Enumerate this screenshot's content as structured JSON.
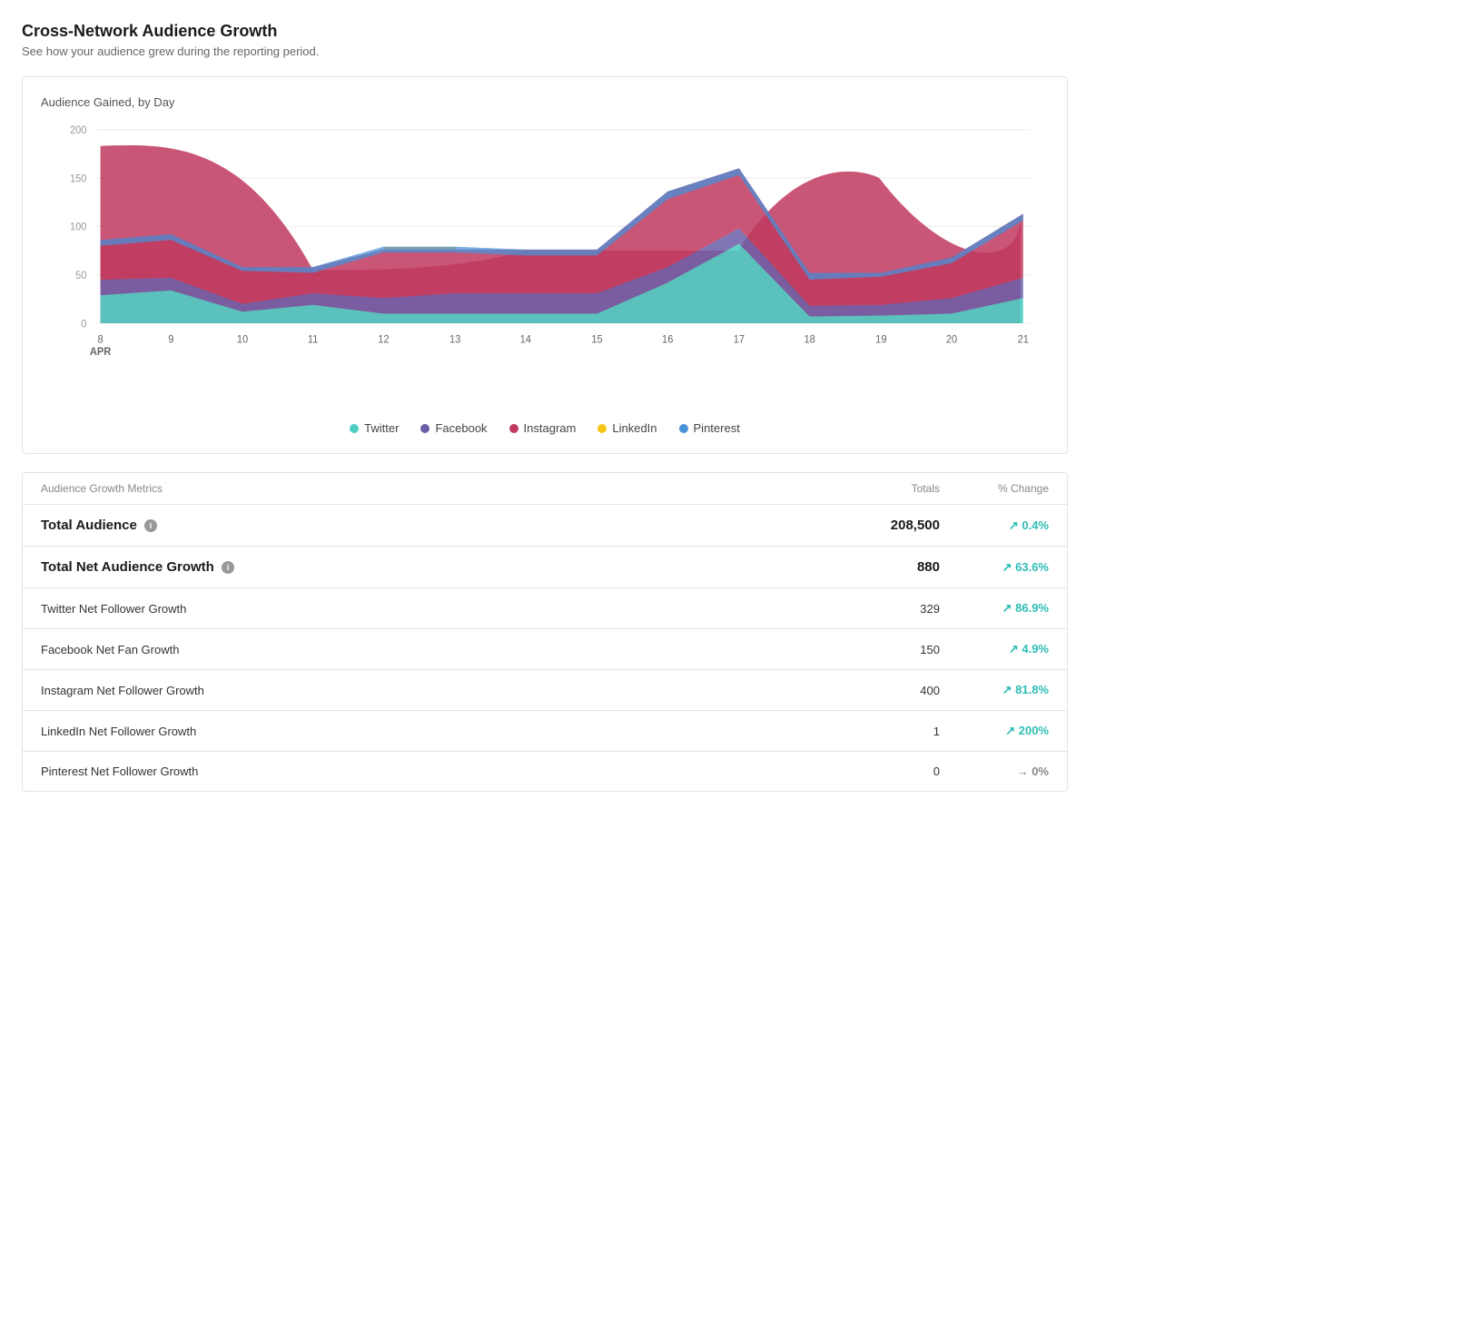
{
  "page": {
    "title": "Cross-Network Audience Growth",
    "subtitle": "See how your audience grew during the reporting period."
  },
  "chart": {
    "y_label": "Audience Gained, by Day",
    "y_ticks": [
      0,
      50,
      100,
      150,
      200
    ],
    "x_labels": [
      "8\nAPR",
      "9",
      "10",
      "11",
      "12",
      "13",
      "14",
      "15",
      "16",
      "17",
      "18",
      "19",
      "20",
      "21"
    ],
    "legend": [
      {
        "label": "Twitter",
        "color": "#4ecdc4"
      },
      {
        "label": "Facebook",
        "color": "#6b5ea8"
      },
      {
        "label": "Instagram",
        "color": "#c0385e"
      },
      {
        "label": "LinkedIn",
        "color": "#f5c518"
      },
      {
        "label": "Pinterest",
        "color": "#4a90d9"
      }
    ]
  },
  "metrics": {
    "header": {
      "label_col": "Audience Growth Metrics",
      "totals_col": "Totals",
      "change_col": "% Change"
    },
    "rows": [
      {
        "label": "Total Audience",
        "has_info": true,
        "total": "208,500",
        "change": "↗ 0.4%",
        "change_type": "positive",
        "is_bold": true
      },
      {
        "label": "Total Net Audience Growth",
        "has_info": true,
        "total": "880",
        "change": "↗ 63.6%",
        "change_type": "positive",
        "is_bold": true
      },
      {
        "label": "Twitter Net Follower Growth",
        "has_info": false,
        "total": "329",
        "change": "↗ 86.9%",
        "change_type": "positive",
        "is_bold": false
      },
      {
        "label": "Facebook Net Fan Growth",
        "has_info": false,
        "total": "150",
        "change": "↗ 4.9%",
        "change_type": "positive",
        "is_bold": false
      },
      {
        "label": "Instagram Net Follower Growth",
        "has_info": false,
        "total": "400",
        "change": "↗ 81.8%",
        "change_type": "positive",
        "is_bold": false
      },
      {
        "label": "LinkedIn Net Follower Growth",
        "has_info": false,
        "total": "1",
        "change": "↗ 200%",
        "change_type": "positive",
        "is_bold": false
      },
      {
        "label": "Pinterest Net Follower Growth",
        "has_info": false,
        "total": "0",
        "change": "→ 0%",
        "change_type": "neutral",
        "is_bold": false
      }
    ]
  }
}
